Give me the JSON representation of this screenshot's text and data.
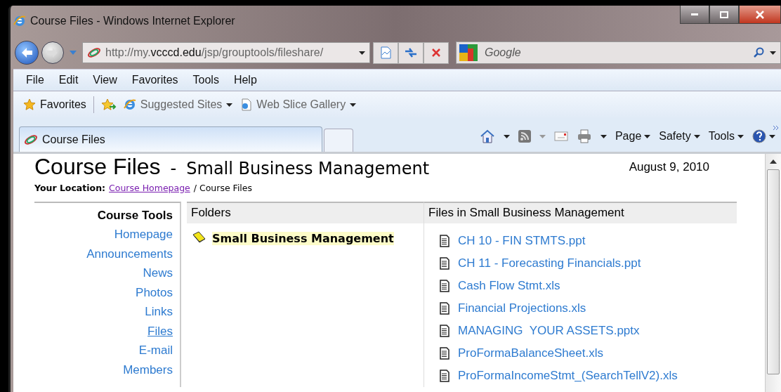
{
  "window": {
    "title": "Course Files - Windows Internet Explorer"
  },
  "address": {
    "url": "http://my.**vcccd.edu**/jsp/grouptools/fileshare/"
  },
  "search": {
    "placeholder": "Google"
  },
  "menu": [
    "File",
    "Edit",
    "View",
    "Favorites",
    "Tools",
    "Help"
  ],
  "favorites_bar": {
    "favorites": "Favorites",
    "items": [
      {
        "label": "Suggested Sites",
        "kind": "ie"
      },
      {
        "label": "Web Slice Gallery",
        "kind": "page"
      }
    ]
  },
  "tabs": [
    {
      "label": "Course Files",
      "selected": true
    }
  ],
  "command_bar": [
    "Page",
    "Safety",
    "Tools"
  ],
  "page": {
    "title": "Course Files",
    "separator": "-",
    "subtitle": "Small Business Management",
    "date": "August 9, 2010",
    "location": {
      "label": "Your Location:",
      "link": "Course Homepage",
      "current": "/ Course Files"
    },
    "sidebar": {
      "heading": "Course Tools",
      "items": [
        {
          "label": "Homepage",
          "selected": false
        },
        {
          "label": "Announcements",
          "selected": false
        },
        {
          "label": "News",
          "selected": false
        },
        {
          "label": "Photos",
          "selected": false
        },
        {
          "label": "Links",
          "selected": false
        },
        {
          "label": "Files",
          "selected": true
        },
        {
          "label": "E-mail",
          "selected": false
        },
        {
          "label": "Members",
          "selected": false
        }
      ]
    },
    "folders": {
      "header": "Folders",
      "items": [
        {
          "label": "Small Business Management",
          "selected": true
        }
      ]
    },
    "files": {
      "header": "Files in Small Business Management",
      "items": [
        "CH 10 - FIN STMTS.ppt",
        "CH 11 - Forecasting Financials.ppt",
        "Cash Flow Stmt.xls",
        "Financial Projections.xls",
        "MANAGING  YOUR ASSETS.pptx",
        "ProFormaBalanceSheet.xls",
        "ProFormaIncomeStmt_(SearchTellV2).xls"
      ]
    }
  }
}
